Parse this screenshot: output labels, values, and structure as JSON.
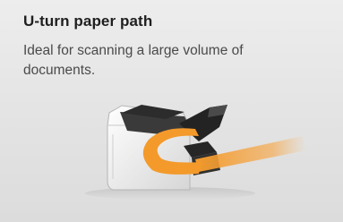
{
  "card": {
    "title": "U-turn paper path",
    "description": "Ideal for scanning a large volume of documents."
  },
  "illustration": {
    "icon": "scanner-u-turn-paper-path",
    "path_color": "#f39a2b"
  }
}
